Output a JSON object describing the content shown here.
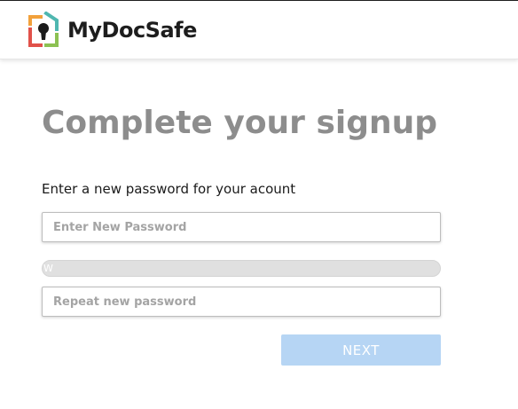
{
  "brand": {
    "name": "MyDocSafe",
    "logo_icon": "keyhole-house-logo-icon",
    "colors": {
      "orange": "#f2a13b",
      "teal": "#4fb7b0",
      "red": "#e1514a",
      "green": "#8cc152",
      "keyhole": "#1b1b1b"
    }
  },
  "page": {
    "title": "Complete your signup",
    "instruction": "Enter a new password for your acount"
  },
  "form": {
    "new_password": {
      "placeholder": "Enter New Password",
      "value": ""
    },
    "strength": {
      "label": "W",
      "level": 0
    },
    "repeat_password": {
      "placeholder": "Repeat new password",
      "value": ""
    },
    "next_label": "NEXT"
  },
  "colors": {
    "title": "#8d8d8d",
    "button_bg": "#b6d5f4",
    "strength_track": "#e0e0e0"
  }
}
